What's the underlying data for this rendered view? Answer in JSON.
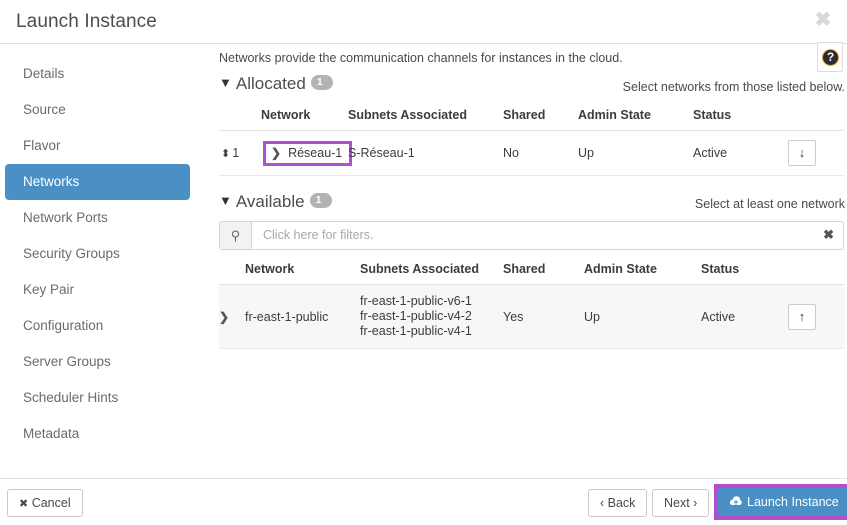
{
  "modal": {
    "title": "Launch Instance",
    "close_icon": "close-icon"
  },
  "sidebar": {
    "items": [
      {
        "label": "Details",
        "active": false
      },
      {
        "label": "Source",
        "active": false
      },
      {
        "label": "Flavor",
        "active": false
      },
      {
        "label": "Networks",
        "active": true
      },
      {
        "label": "Network Ports",
        "active": false
      },
      {
        "label": "Security Groups",
        "active": false
      },
      {
        "label": "Key Pair",
        "active": false
      },
      {
        "label": "Configuration",
        "active": false
      },
      {
        "label": "Server Groups",
        "active": false
      },
      {
        "label": "Scheduler Hints",
        "active": false
      },
      {
        "label": "Metadata",
        "active": false
      }
    ]
  },
  "main": {
    "intro": "Networks provide the communication channels for instances in the cloud.",
    "help_icon": "help-question-icon",
    "help_glyph": "?",
    "allocated": {
      "caret": "⌄",
      "title": "Allocated",
      "count": "1",
      "hint": "Select networks from those listed below.",
      "columns": [
        "",
        "Network",
        "Subnets Associated",
        "Shared",
        "Admin State",
        "Status",
        ""
      ],
      "rows": [
        {
          "order": "1",
          "drag_glyph": "⬍",
          "expand_glyph": "❯",
          "network": "Réseau-1",
          "subnets": [
            "S-Réseau-1"
          ],
          "shared": "No",
          "admin_state": "Up",
          "status": "Active",
          "action_glyph": "↓",
          "action_name": "move-down-button",
          "highlighted": true
        }
      ]
    },
    "available": {
      "caret": "⌄",
      "title": "Available",
      "count": "1",
      "hint": "Select at least one network",
      "filter": {
        "search_icon": "search-icon",
        "placeholder": "Click here for filters.",
        "value": "",
        "clear_glyph": "✖"
      },
      "columns": [
        "",
        "Network",
        "Subnets Associated",
        "Shared",
        "Admin State",
        "Status",
        ""
      ],
      "rows": [
        {
          "expand_glyph": "❯",
          "network": "fr-east-1-public",
          "subnets": [
            "fr-east-1-public-v6-1",
            "fr-east-1-public-v4-2",
            "fr-east-1-public-v4-1"
          ],
          "shared": "Yes",
          "admin_state": "Up",
          "status": "Active",
          "action_glyph": "↑",
          "action_name": "move-up-button"
        }
      ]
    }
  },
  "footer": {
    "cancel": "Cancel",
    "cancel_glyph": "✖",
    "back": "‹ Back",
    "next": "Next ›",
    "launch": "Launch Instance",
    "launch_icon": "cloud-upload-icon"
  },
  "colors": {
    "accent_blue": "#4a90c4",
    "highlight_purple": "#b24fd0",
    "badge_gray": "#b3b3b3"
  }
}
